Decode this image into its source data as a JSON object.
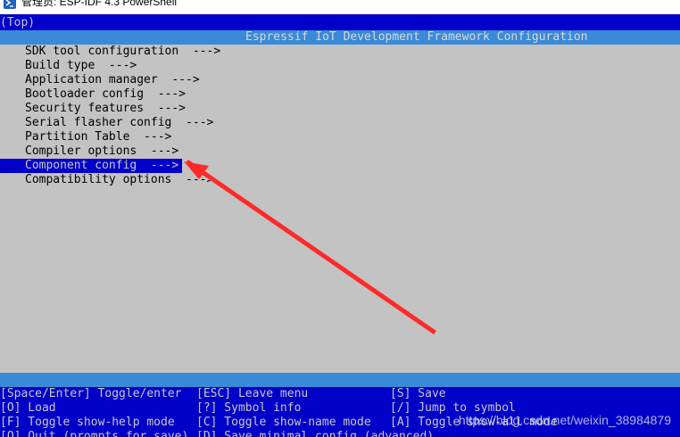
{
  "window": {
    "title": "管理员: ESP-IDF 4.3 PowerShell",
    "icon": "powershell-icon"
  },
  "breadcrumb": "(Top)",
  "header": {
    "title": "Espressif IoT Development Framework Configuration"
  },
  "menu": {
    "selected_index": 7,
    "items": [
      {
        "label": "SDK tool configuration  --->"
      },
      {
        "label": "Build type  --->"
      },
      {
        "label": "Application manager  --->"
      },
      {
        "label": "Bootloader config  --->"
      },
      {
        "label": "Security features  --->"
      },
      {
        "label": "Serial flasher config  --->"
      },
      {
        "label": "Partition Table  --->"
      },
      {
        "label": "Compiler options  --->"
      },
      {
        "label": "Component config  --->"
      },
      {
        "label": "Compatibility options  --->"
      }
    ]
  },
  "keys": {
    "row1": {
      "toggle_enter": "[Space/Enter] Toggle/enter",
      "leave_menu": "[ESC] Leave menu",
      "save": "[S] Save"
    },
    "row2": {
      "load": "[O] Load",
      "symbol_info": "[?] Symbol info",
      "jump": "[/] Jump to symbol"
    },
    "row3": {
      "show_help": "[F] Toggle show-help mode",
      "show_name": "[C] Toggle show-name mode",
      "show_all": "[A] Toggle show-all mode"
    },
    "row4": {
      "quit": "[Q] Quit (prompts for save)",
      "save_minimal": "[D] Save minimal config (advanced)"
    }
  },
  "watermark": "https://blog.csdn.net/weixin_38984879",
  "colors": {
    "console_bg": "#0000c8",
    "menu_bg": "#c3c3c3",
    "bar_blue": "#3b8ad8",
    "annotation_red": "#ff2a2a"
  }
}
